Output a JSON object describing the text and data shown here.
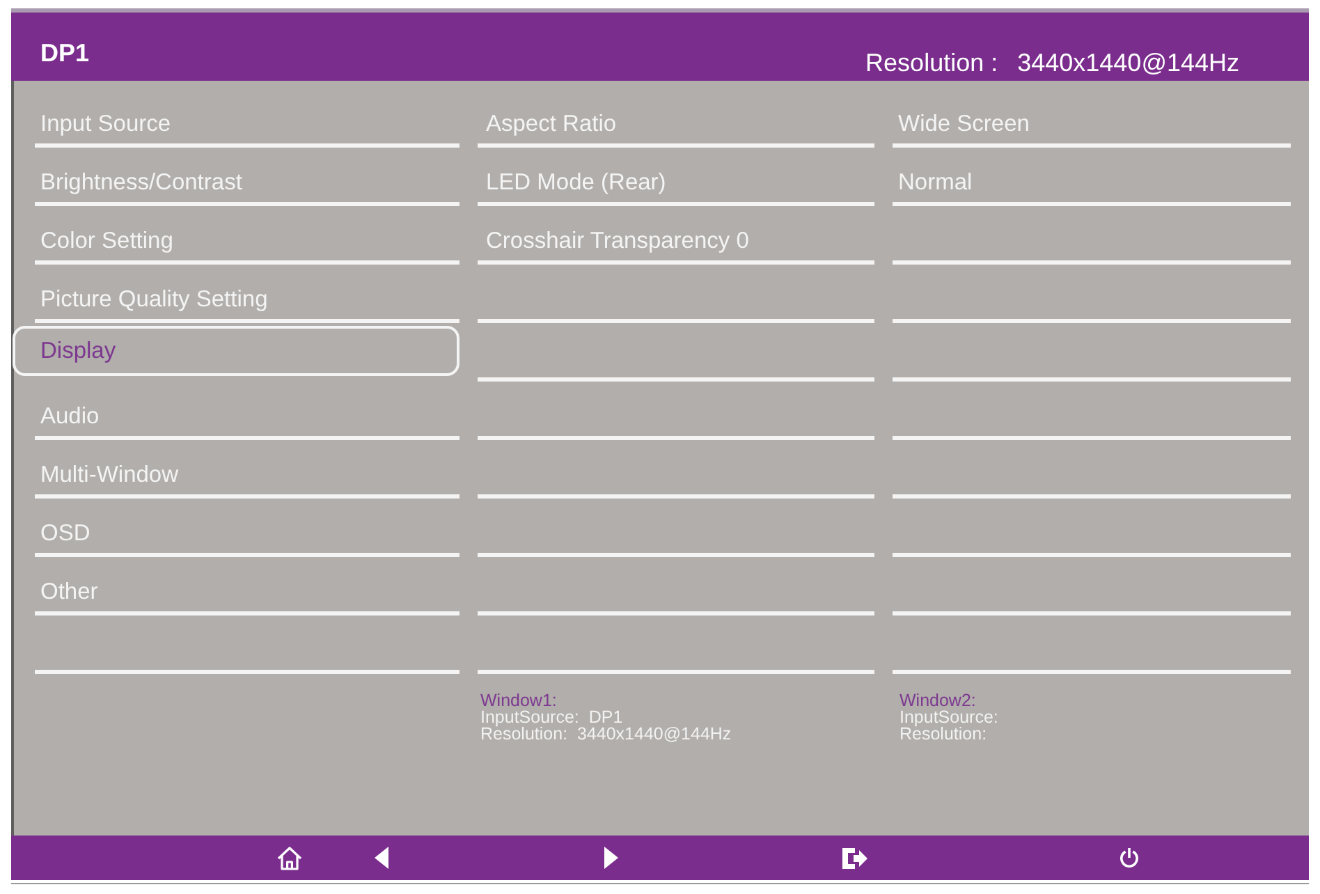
{
  "header": {
    "source": "DP1",
    "resolution_label": "Resolution :",
    "resolution": "3440x1440@144Hz"
  },
  "menu": [
    {
      "label": "Input Source",
      "selected": false
    },
    {
      "label": "Brightness/Contrast",
      "selected": false
    },
    {
      "label": "Color Setting",
      "selected": false
    },
    {
      "label": "Picture Quality Setting",
      "selected": false
    },
    {
      "label": "Display",
      "selected": true
    },
    {
      "label": "Audio",
      "selected": false
    },
    {
      "label": "Multi-Window",
      "selected": false
    },
    {
      "label": "OSD",
      "selected": false
    },
    {
      "label": "Other",
      "selected": false
    }
  ],
  "submenu": [
    "Aspect Ratio",
    "LED Mode (Rear)",
    "Crosshair Transparency 0"
  ],
  "values": [
    "Wide Screen",
    "Normal"
  ],
  "windows": [
    {
      "title": "Window1:",
      "input_source": "InputSource:  DP1",
      "resolution": "Resolution:  3440x1440@144Hz"
    },
    {
      "title": "Window2:",
      "input_source": "InputSource:",
      "resolution": "Resolution:"
    }
  ],
  "footer": [
    {
      "kind": "home"
    },
    {
      "kind": "left"
    },
    {
      "kind": "right"
    },
    {
      "kind": "exit"
    },
    {
      "kind": "power"
    }
  ]
}
